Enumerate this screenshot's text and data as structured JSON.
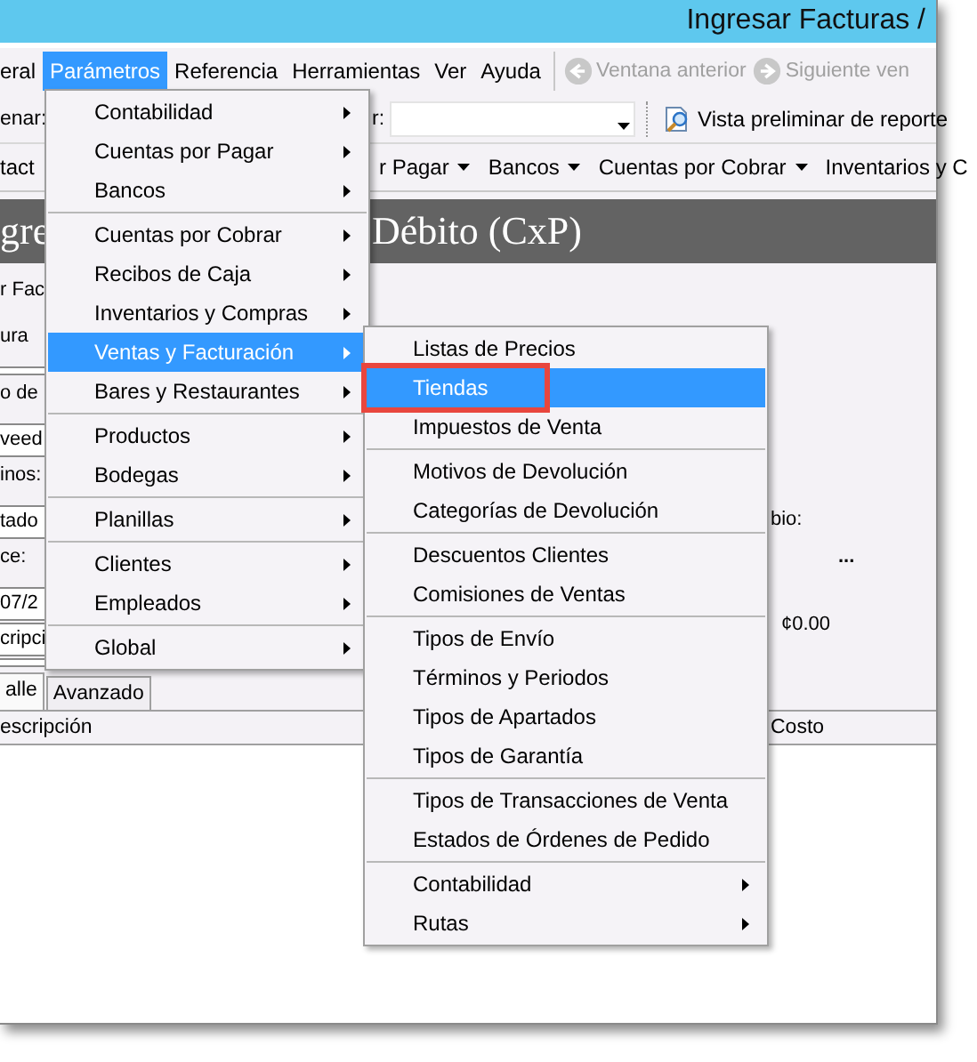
{
  "window": {
    "title": "Ingresar Facturas /"
  },
  "menu_bar": [
    {
      "label": "eral",
      "selected": false
    },
    {
      "label": "Parámetros",
      "selected": true
    },
    {
      "label": "Referencia",
      "selected": false
    },
    {
      "label": "Herramientas",
      "selected": false
    },
    {
      "label": "Ver",
      "selected": false
    },
    {
      "label": "Ayuda",
      "selected": false
    }
  ],
  "nav_buttons": [
    {
      "label": "Ventana anterior",
      "disabled": true,
      "kind": "back"
    },
    {
      "label": "Siguiente ven",
      "disabled": true,
      "kind": "forward"
    }
  ],
  "toolbar": {
    "label_1": "enar:",
    "label_2": "r:",
    "report_button": "Vista preliminar de reporte"
  },
  "quick_menus": [
    {
      "label": "tact",
      "dropdown": false
    },
    {
      "label": "r Pagar",
      "dropdown": true
    },
    {
      "label": "Bancos",
      "dropdown": true
    },
    {
      "label": "Cuentas por Cobrar",
      "dropdown": true
    },
    {
      "label": "Inventarios y C",
      "dropdown": false
    }
  ],
  "header": {
    "title_left": "gre",
    "title_right": "Débito (CxP)"
  },
  "form_left": [
    {
      "kind": "label",
      "text": "r Fac"
    },
    {
      "kind": "label",
      "text": "ura"
    },
    {
      "kind": "field"
    },
    {
      "kind": "label",
      "text": "o de"
    },
    {
      "kind": "field",
      "value": "veed"
    },
    {
      "kind": "label",
      "text": "inos:"
    },
    {
      "kind": "field",
      "value": "tado"
    },
    {
      "kind": "label",
      "text": "ce:"
    },
    {
      "kind": "field",
      "value": "07/2"
    },
    {
      "kind": "field",
      "value": "cripci"
    },
    {
      "kind": "field"
    }
  ],
  "form_right": {
    "label": "bio:",
    "browse_button": "...",
    "amount": "¢0.00"
  },
  "tabs": [
    {
      "label": "alle",
      "selected": true
    },
    {
      "label": "Avanzado",
      "selected": false
    }
  ],
  "table": {
    "columns": [
      "escripción",
      "Costo"
    ]
  },
  "parameters_menu": {
    "groups": [
      {
        "items": [
          {
            "label": "Contabilidad",
            "submenu": true,
            "selected": false
          },
          {
            "label": "Cuentas por Pagar",
            "submenu": true,
            "selected": false
          },
          {
            "label": "Bancos",
            "submenu": true,
            "selected": false
          }
        ]
      },
      {
        "items": [
          {
            "label": "Cuentas por Cobrar",
            "submenu": true,
            "selected": false
          },
          {
            "label": "Recibos de Caja",
            "submenu": true,
            "selected": false
          },
          {
            "label": "Inventarios y Compras",
            "submenu": true,
            "selected": false
          },
          {
            "label": "Ventas y Facturación",
            "submenu": true,
            "selected": true
          },
          {
            "label": "Bares y Restaurantes",
            "submenu": true,
            "selected": false
          }
        ]
      },
      {
        "items": [
          {
            "label": "Productos",
            "submenu": true,
            "selected": false
          },
          {
            "label": "Bodegas",
            "submenu": true,
            "selected": false
          }
        ]
      },
      {
        "items": [
          {
            "label": "Planillas",
            "submenu": true,
            "selected": false
          }
        ]
      },
      {
        "items": [
          {
            "label": "Clientes",
            "submenu": true,
            "selected": false
          },
          {
            "label": "Empleados",
            "submenu": true,
            "selected": false
          }
        ]
      },
      {
        "items": [
          {
            "label": "Global",
            "submenu": true,
            "selected": false
          }
        ]
      }
    ]
  },
  "sales_submenu": {
    "groups": [
      {
        "items": [
          {
            "label": "Listas de Precios",
            "submenu": false,
            "selected": false,
            "highlighted": false
          },
          {
            "label": "Tiendas",
            "submenu": false,
            "selected": true,
            "highlighted": true
          },
          {
            "label": "Impuestos de Venta",
            "submenu": false,
            "selected": false,
            "highlighted": false
          }
        ]
      },
      {
        "items": [
          {
            "label": "Motivos de Devolución",
            "submenu": false,
            "selected": false,
            "highlighted": false
          },
          {
            "label": "Categorías de Devolución",
            "submenu": false,
            "selected": false,
            "highlighted": false
          }
        ]
      },
      {
        "items": [
          {
            "label": "Descuentos Clientes",
            "submenu": false,
            "selected": false,
            "highlighted": false
          },
          {
            "label": "Comisiones de Ventas",
            "submenu": false,
            "selected": false,
            "highlighted": false
          }
        ]
      },
      {
        "items": [
          {
            "label": "Tipos de Envío",
            "submenu": false,
            "selected": false,
            "highlighted": false
          },
          {
            "label": "Términos y Periodos",
            "submenu": false,
            "selected": false,
            "highlighted": false
          },
          {
            "label": "Tipos de Apartados",
            "submenu": false,
            "selected": false,
            "highlighted": false
          },
          {
            "label": "Tipos de Garantía",
            "submenu": false,
            "selected": false,
            "highlighted": false
          }
        ]
      },
      {
        "items": [
          {
            "label": "Tipos de Transacciones de Venta",
            "submenu": false,
            "selected": false,
            "highlighted": false
          },
          {
            "label": "Estados de Órdenes de Pedido",
            "submenu": false,
            "selected": false,
            "highlighted": false
          }
        ]
      },
      {
        "items": [
          {
            "label": "Contabilidad",
            "submenu": true,
            "selected": false,
            "highlighted": false
          },
          {
            "label": "Rutas",
            "submenu": true,
            "selected": false,
            "highlighted": false
          }
        ]
      }
    ]
  }
}
